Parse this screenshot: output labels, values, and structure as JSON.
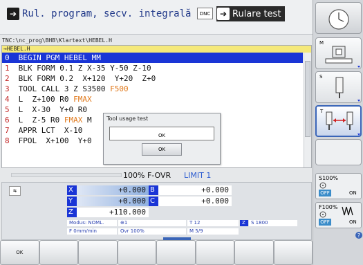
{
  "header": {
    "mode_left": "Rul. program, secv. integrală",
    "dnc_label": "DNC",
    "mode_right": "Rulare test"
  },
  "path": "TNC:\\nc_prog\\BHB\\Klartext\\HEBEL.H",
  "program": {
    "filename": "→HEBEL.H",
    "lines": [
      {
        "n": "0",
        "text": " BEGIN PGM HEBEL MM",
        "feed": ""
      },
      {
        "n": "1",
        "text": " BLK FORM 0.1 Z X-35 Y-50 Z-10",
        "feed": ""
      },
      {
        "n": "2",
        "text": " BLK FORM 0.2  X+120  Y+20  Z+0",
        "feed": ""
      },
      {
        "n": "3",
        "text": " TOOL CALL 3 Z S3500 ",
        "feed": "F500"
      },
      {
        "n": "4",
        "text": " L  Z+100 R0 ",
        "feed": "FMAX"
      },
      {
        "n": "5",
        "text": " L  X-30  Y+0 R0 ",
        "feed": ""
      },
      {
        "n": "6",
        "text": " L  Z-5 R0 ",
        "feed": "FMAX",
        "tail": " M"
      },
      {
        "n": "7",
        "text": " APPR LCT  X-10",
        "feed": ""
      },
      {
        "n": "8",
        "text": " FPOL  X+100  Y+0",
        "feed": ""
      }
    ]
  },
  "dialog": {
    "title": "Tool usage test",
    "message": "OK",
    "button": "OK"
  },
  "override": {
    "feed_override": "100% F-OVR",
    "limit": "LIMIT 1"
  },
  "positions": {
    "x_label": "X",
    "x_value": "+0.000",
    "b_label": "B",
    "b_value": "+0.000",
    "y_label": "Y",
    "y_value": "+0.000",
    "c_label": "C",
    "c_value": "+0.000",
    "z_label": "Z",
    "z_value": "+110.000"
  },
  "info": {
    "mode": "Modus: NOML.",
    "tool_ref": "⊕1",
    "tool": "T 12",
    "spindle": "S 1800",
    "spindle_axis": "Z",
    "feed": "F 0mm/min",
    "ovr": "Ovr 100%",
    "m": "M 5/9"
  },
  "right_softkeys": {
    "m_label": "M",
    "s_label": "S",
    "t_label": "T",
    "s_status": {
      "pct": "S100%",
      "off": "OFF",
      "on": "ON"
    },
    "f_status": {
      "pct": "F100%",
      "off": "OFF",
      "on": "ON"
    }
  },
  "bottom_softkeys": [
    "OK",
    "",
    "",
    "",
    "",
    "",
    "",
    ""
  ],
  "colors": {
    "selection": "#1a35d6",
    "accent": "#3a65b8",
    "feed": "#e0781a",
    "line_number": "#c02020"
  }
}
